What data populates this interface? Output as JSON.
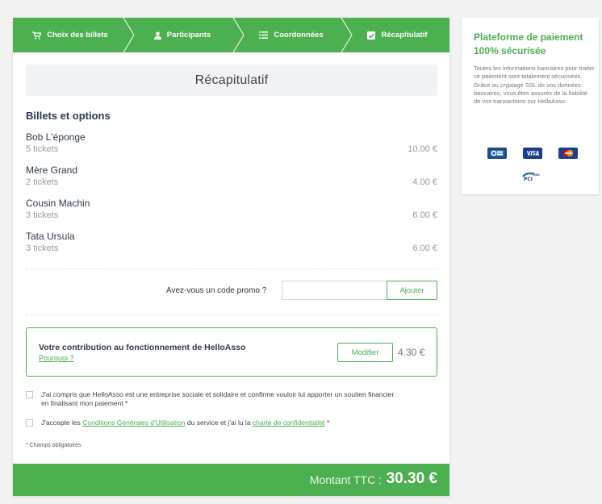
{
  "steps": [
    {
      "label": "Choix des billets",
      "icon": "cart-icon"
    },
    {
      "label": "Participants",
      "icon": "person-icon"
    },
    {
      "label": "Coordonnées",
      "icon": "list-icon"
    },
    {
      "label": "Récapitulatif",
      "icon": "checkbox-icon"
    }
  ],
  "recap": {
    "title": "Récapitulatif"
  },
  "section_title": "Billets et options",
  "tickets": [
    {
      "name": "Bob L'éponge",
      "qty": "5 tickets",
      "price": "10.00 €"
    },
    {
      "name": "Mère Grand",
      "qty": "2 tickets",
      "price": "4.00 €"
    },
    {
      "name": "Cousin Machin",
      "qty": "3 tickets",
      "price": "6.00 €"
    },
    {
      "name": "Tata Ursula",
      "qty": "3 tickets",
      "price": "6.00 €"
    }
  ],
  "promo": {
    "label": "Avez-vous un code promo ?",
    "value": "",
    "button": "Ajouter"
  },
  "contribution": {
    "title": "Votre contribution au fonctionnement de HelloAsso",
    "link": "Pourquoi ?",
    "modify": "Modifier",
    "amount": "4.30 €"
  },
  "checks": {
    "social_line1": "J'ai compris que HelloAsso est une entreprise sociale et solidaire et confirme vouloir lui apporter un soutien financier",
    "social_line2": "en finalisant mon paiement *",
    "cgu_prefix": "J'accepte les ",
    "cgu_link": "Conditions Générales d'Utilisation",
    "cgu_middle": " du service et j'ai lu la ",
    "privacy_link": "charte de confidentialité",
    "cgu_suffix": " *"
  },
  "mandatory": "* Champs obligatoires",
  "total": {
    "label": "Montant TTC :",
    "value": "30.30 €"
  },
  "side": {
    "title": "Plateforme de paiement 100% sécurisée",
    "text": "Toutes les informations bancaires pour traiter ce paiement sont totalement sécurisées. Grâce au cryptage SSL de vos données bancaires, vous êtes assurés de la fiabilité de vos transactions sur HelloAsso."
  },
  "payment_logos": [
    "cb-logo",
    "visa-logo",
    "mastercard-logo",
    "pci-dss-logo"
  ],
  "colors": {
    "accent": "#4caf50",
    "header_bg": "#f1f3f6",
    "text_dark": "#2e3a4b"
  }
}
